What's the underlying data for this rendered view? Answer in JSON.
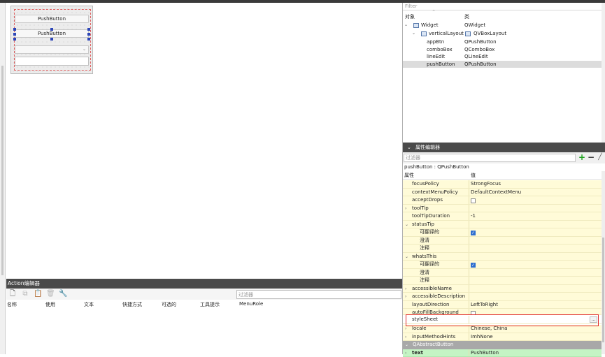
{
  "form": {
    "button1_label": "PushButton",
    "button2_label": "PushButton",
    "combo_arrow": "⌄"
  },
  "action_editor": {
    "title": "Action编辑器",
    "filter_placeholder": "过滤器",
    "columns": [
      "名称",
      "使用",
      "文本",
      "快捷方式",
      "可选的",
      "工具提示",
      "MenuRole"
    ]
  },
  "object_inspector": {
    "filter_placeholder": "Filter",
    "col_object": "对象",
    "col_class": "类",
    "rows": [
      {
        "name": "Widget",
        "cls": "QWidget"
      },
      {
        "name": "verticalLayout",
        "cls": "QVBoxLayout"
      },
      {
        "name": "appBtn",
        "cls": "QPushButton"
      },
      {
        "name": "comboBox",
        "cls": "QComboBox"
      },
      {
        "name": "lineEdit",
        "cls": "QLineEdit"
      },
      {
        "name": "pushButton",
        "cls": "QPushButton"
      }
    ]
  },
  "property_editor": {
    "title": "属性编辑器",
    "filter_placeholder": "过滤器",
    "object_label": "pushButton : QPushButton",
    "col_property": "属性",
    "col_value": "值",
    "rows": [
      {
        "name": "focusPolicy",
        "value": "StrongFocus"
      },
      {
        "name": "contextMenuPolicy",
        "value": "DefaultContextMenu"
      },
      {
        "name": "acceptDrops",
        "value": ""
      },
      {
        "name": "toolTip",
        "value": ""
      },
      {
        "name": "toolTipDuration",
        "value": "-1"
      },
      {
        "name": "statusTip",
        "value": ""
      },
      {
        "name": "可翻译的",
        "value": ""
      },
      {
        "name": "澄清",
        "value": ""
      },
      {
        "name": "注释",
        "value": ""
      },
      {
        "name": "whatsThis",
        "value": ""
      },
      {
        "name": "可翻译的",
        "value": ""
      },
      {
        "name": "澄清",
        "value": ""
      },
      {
        "name": "注释",
        "value": ""
      },
      {
        "name": "accessibleName",
        "value": ""
      },
      {
        "name": "accessibleDescription",
        "value": ""
      },
      {
        "name": "layoutDirection",
        "value": "LeftToRight"
      },
      {
        "name": "autoFillBackground",
        "value": ""
      },
      {
        "name": "styleSheet",
        "value": ""
      },
      {
        "name": "locale",
        "value": "Chinese, China"
      },
      {
        "name": "inputMethodHints",
        "value": "ImhNone"
      },
      {
        "name": "QAbstractButton",
        "value": ""
      },
      {
        "name": "text",
        "value": "PushButton"
      }
    ],
    "stylesheet_button": "..."
  },
  "colors": {
    "property_row_bg": "#fffbd8",
    "section_bg": "#a8a8a8",
    "text_row_bg": "#c4f4c4",
    "highlight_border": "#e02a2a",
    "dark_header": "#4a4a4a"
  }
}
